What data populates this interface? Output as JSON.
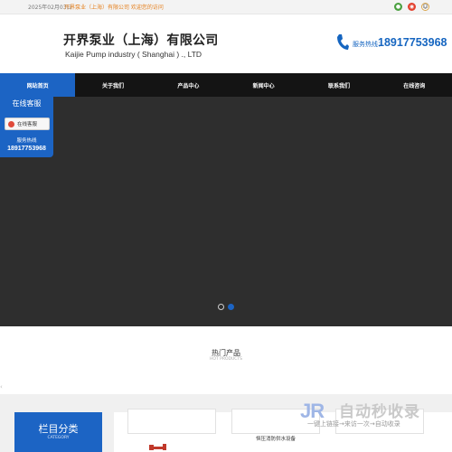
{
  "topbar": {
    "date": "2025年02月03日",
    "welcome": "开界泵业（上海）有限公司 欢迎您的访问",
    "icons": [
      "wechat-icon",
      "weibo-icon",
      "qq-icon"
    ]
  },
  "header": {
    "company_cn": "开界泵业（上海）有限公司",
    "company_en": "Kaijie Pump industry ( Shanghai ) ., LTD",
    "hotline_label": "服务热线：",
    "hotline_number": "18917753968"
  },
  "nav": {
    "items": [
      "网站首页",
      "关于我们",
      "产品中心",
      "新闻中心",
      "联系我们",
      "在线咨询"
    ],
    "active_index": 0
  },
  "banner": {
    "slides": 2,
    "active_slide": 2
  },
  "customer_service": {
    "title": "在线客服",
    "button_label": "在线客服",
    "tel_label": "服务热线",
    "tel_number": "18917753968"
  },
  "hot_products": {
    "title": "热门产品",
    "subtitle": "HOT PRODUCTS"
  },
  "category": {
    "title": "栏目分类",
    "subtitle": "CATEGORY"
  },
  "products": {
    "visible_label": "恒压消防供水设备"
  },
  "watermark": {
    "logo": "JR",
    "brand": "自动秒收录",
    "slogan": "一键上链接→来访一次→自动收录"
  },
  "colors": {
    "accent": "#1c64c4",
    "nav_bg": "#141414",
    "banner_bg": "#2e2e2e",
    "welcome_text": "#e5801e"
  }
}
